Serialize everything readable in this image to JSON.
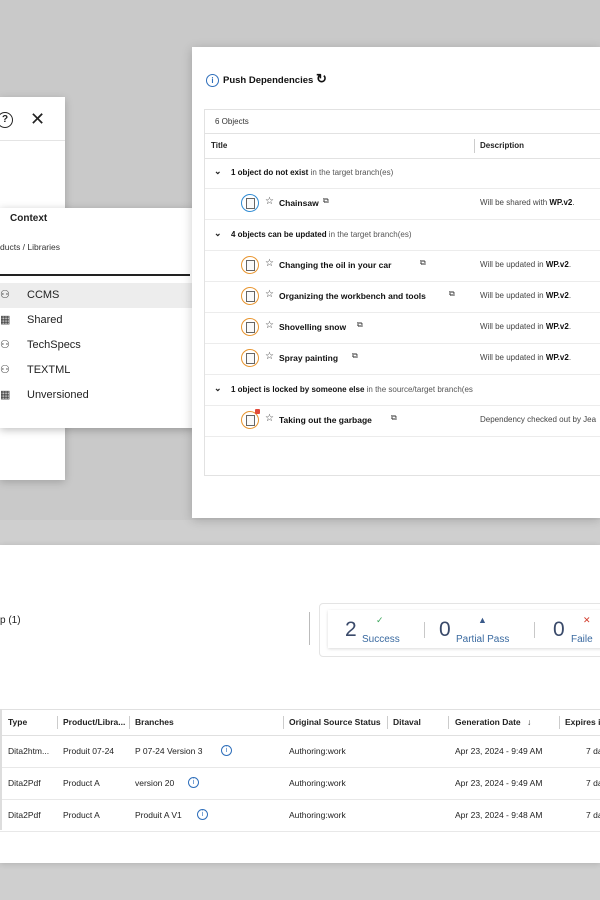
{
  "left_dialog": {
    "help_icon": "question-circle-icon",
    "close_icon": "close-icon"
  },
  "context": {
    "title": "Context",
    "path": "ducts / Libraries",
    "items": [
      {
        "label": "CCMS",
        "icon": "hierarchy-icon",
        "selected": true
      },
      {
        "label": "Shared",
        "icon": "building-icon",
        "selected": false
      },
      {
        "label": "TechSpecs",
        "icon": "hierarchy-icon",
        "selected": false
      },
      {
        "label": "TEXTML",
        "icon": "hierarchy-icon",
        "selected": false
      },
      {
        "label": "Unversioned",
        "icon": "building-icon",
        "selected": false
      }
    ]
  },
  "push": {
    "title": "Push Dependencies",
    "count_label": "6 Objects",
    "col_title": "Title",
    "col_description": "Description",
    "groups": [
      {
        "bold": "1 object do not exist",
        "rest": " in the target branch(es)",
        "items": [
          {
            "title": "Chainsaw",
            "desc_prefix": "Will be shared with ",
            "desc_bold": "WP.v2",
            "desc_suffix": ".",
            "badge": "blue",
            "locked": false
          }
        ]
      },
      {
        "bold": "4 objects can be updated",
        "rest": " in the target branch(es)",
        "items": [
          {
            "title": "Changing the oil in your car",
            "desc_prefix": "Will be updated in ",
            "desc_bold": "WP.v2",
            "desc_suffix": ".",
            "badge": "orange",
            "locked": false
          },
          {
            "title": "Organizing the workbench and tools",
            "desc_prefix": "Will be updated in ",
            "desc_bold": "WP.v2",
            "desc_suffix": ".",
            "badge": "orange",
            "locked": false
          },
          {
            "title": "Shovelling snow",
            "desc_prefix": "Will be updated in ",
            "desc_bold": "WP.v2",
            "desc_suffix": ".",
            "badge": "orange",
            "locked": false
          },
          {
            "title": "Spray painting",
            "desc_prefix": "Will be updated in ",
            "desc_bold": "WP.v2",
            "desc_suffix": ".",
            "badge": "orange",
            "locked": false
          }
        ]
      },
      {
        "bold": "1 object is locked by someone else",
        "rest": " in the source/target branch(es",
        "items": [
          {
            "title": "Taking out the garbage",
            "desc_prefix": "Dependency checked out by Jea",
            "desc_bold": "",
            "desc_suffix": "",
            "badge": "orange",
            "locked": true
          }
        ]
      }
    ]
  },
  "summary": {
    "label": "p (1)",
    "stats": [
      {
        "num": "2",
        "label": "Success",
        "icon": "✓",
        "color": "#3aa55a"
      },
      {
        "num": "0",
        "label": "Partial Pass",
        "icon": "▲",
        "color": "#3a5a8a"
      },
      {
        "num": "0",
        "label": "Faile",
        "icon": "✕",
        "color": "#d23a2a"
      }
    ]
  },
  "results": {
    "headers": [
      "Type",
      "Product/Libra...",
      "Branches",
      "Original Source Status",
      "Ditaval",
      "Generation Date",
      "Expires in"
    ],
    "rows": [
      {
        "type": "Dita2htm...",
        "product": "Produit 07-24",
        "branch": "P 07-24 Version 3",
        "status": "Authoring:work",
        "ditaval": "",
        "date": "Apr 23, 2024 - 9:49 AM",
        "expires": "7 da"
      },
      {
        "type": "Dita2Pdf",
        "product": "Product A",
        "branch": "version 20",
        "status": "Authoring:work",
        "ditaval": "",
        "date": "Apr 23, 2024 - 9:49 AM",
        "expires": "7 da"
      },
      {
        "type": "Dita2Pdf",
        "product": "Product A",
        "branch": "Produit A V1",
        "status": "Authoring:work",
        "ditaval": "",
        "date": "Apr 23, 2024 - 9:48 AM",
        "expires": "7 da"
      }
    ]
  }
}
